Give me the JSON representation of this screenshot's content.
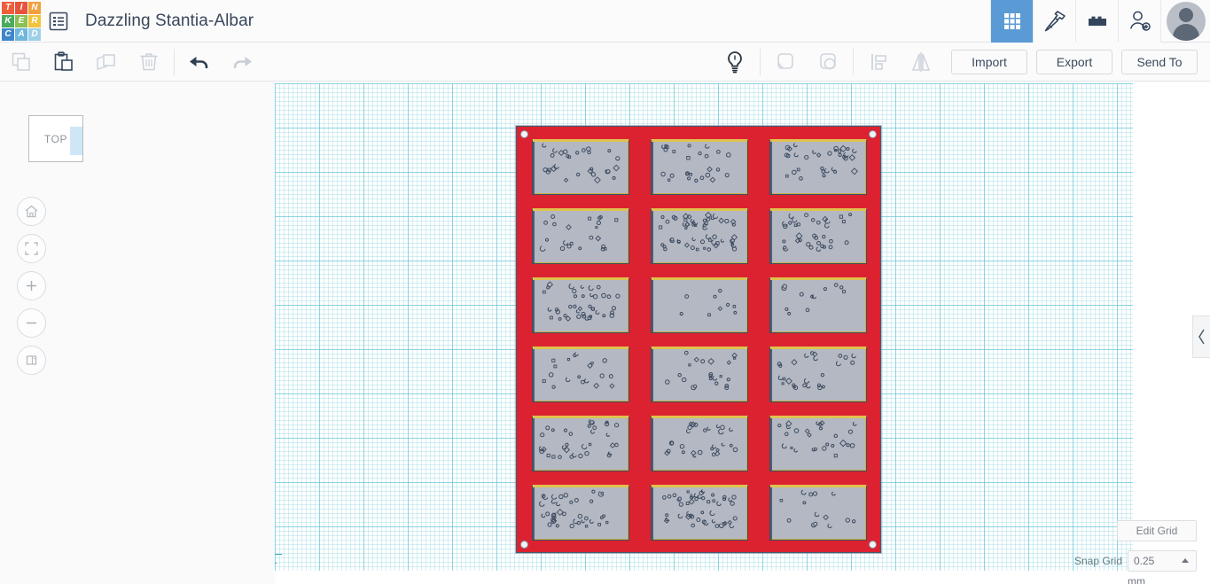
{
  "app": {
    "logo_letters": [
      "T",
      "I",
      "N",
      "K",
      "E",
      "R",
      "C",
      "A",
      "D"
    ],
    "logo_colors": [
      "#ef5e3a",
      "#e8533c",
      "#f2a03c",
      "#4aab5e",
      "#8cc152",
      "#f2c33c",
      "#3d87c9",
      "#6fb7dd",
      "#9fd0e8"
    ],
    "document_title": "Dazzling Stantia-Albar",
    "doc_list_icon": "list-icon"
  },
  "topbar": {
    "icons": [
      {
        "name": "grid-view-icon",
        "active": true
      },
      {
        "name": "hammer-icon",
        "active": false
      },
      {
        "name": "brick-icon",
        "active": false
      },
      {
        "name": "add-person-icon",
        "active": false
      }
    ],
    "avatar_label": "user-avatar"
  },
  "toolbar": {
    "left_tools": [
      {
        "name": "copy-icon",
        "enabled": false
      },
      {
        "name": "paste-icon",
        "enabled": true
      },
      {
        "name": "duplicate-icon",
        "enabled": false
      },
      {
        "name": "delete-icon",
        "enabled": false
      },
      {
        "name": "undo-icon",
        "enabled": true
      },
      {
        "name": "redo-icon",
        "enabled": false
      }
    ],
    "right_tools": [
      {
        "name": "lightbulb-icon",
        "enabled": true
      },
      {
        "name": "group-icon",
        "enabled": false
      },
      {
        "name": "ungroup-icon",
        "enabled": false
      },
      {
        "name": "align-icon",
        "enabled": false
      },
      {
        "name": "mirror-icon",
        "enabled": false
      }
    ],
    "import_label": "Import",
    "export_label": "Export",
    "sendto_label": "Send To"
  },
  "viewcube": {
    "face_label": "TOP"
  },
  "nav_buttons": [
    {
      "name": "home-view-icon",
      "label": "home"
    },
    {
      "name": "fit-view-icon",
      "label": "fit all"
    },
    {
      "name": "zoom-in-icon",
      "label": "zoom in"
    },
    {
      "name": "zoom-out-icon",
      "label": "zoom out"
    },
    {
      "name": "perspective-toggle-icon",
      "label": "orthographic"
    }
  ],
  "grid_controls": {
    "edit_grid_label": "Edit Grid",
    "snap_grid_label": "Snap Grid",
    "snap_value": "0.25",
    "unit": "mm"
  },
  "right_panel_toggle": {
    "icon": "chevron-left-icon"
  },
  "model": {
    "plate_color": "#dc2230",
    "panel_face_color": "#b3b8c3",
    "panel_top_edge_color": "#e0c24e",
    "panel_side_edge_color": "#4e5d72",
    "outline_color": "#3f4d60",
    "handle_color": "#f2f3f4",
    "rows": 6,
    "cols": 3,
    "panel_count": 18,
    "panel_seeds": [
      {
        "seed": 11,
        "density": 28
      },
      {
        "seed": 23,
        "density": 26
      },
      {
        "seed": 37,
        "density": 32
      },
      {
        "seed": 41,
        "density": 22
      },
      {
        "seed": 59,
        "density": 55
      },
      {
        "seed": 67,
        "density": 34
      },
      {
        "seed": 71,
        "density": 40
      },
      {
        "seed": 83,
        "density": 9
      },
      {
        "seed": 97,
        "density": 12
      },
      {
        "seed": 103,
        "density": 19
      },
      {
        "seed": 113,
        "density": 22
      },
      {
        "seed": 127,
        "density": 26
      },
      {
        "seed": 131,
        "density": 33
      },
      {
        "seed": 149,
        "density": 28
      },
      {
        "seed": 151,
        "density": 26
      },
      {
        "seed": 163,
        "density": 38
      },
      {
        "seed": 179,
        "density": 48
      },
      {
        "seed": 191,
        "density": 14
      }
    ]
  }
}
